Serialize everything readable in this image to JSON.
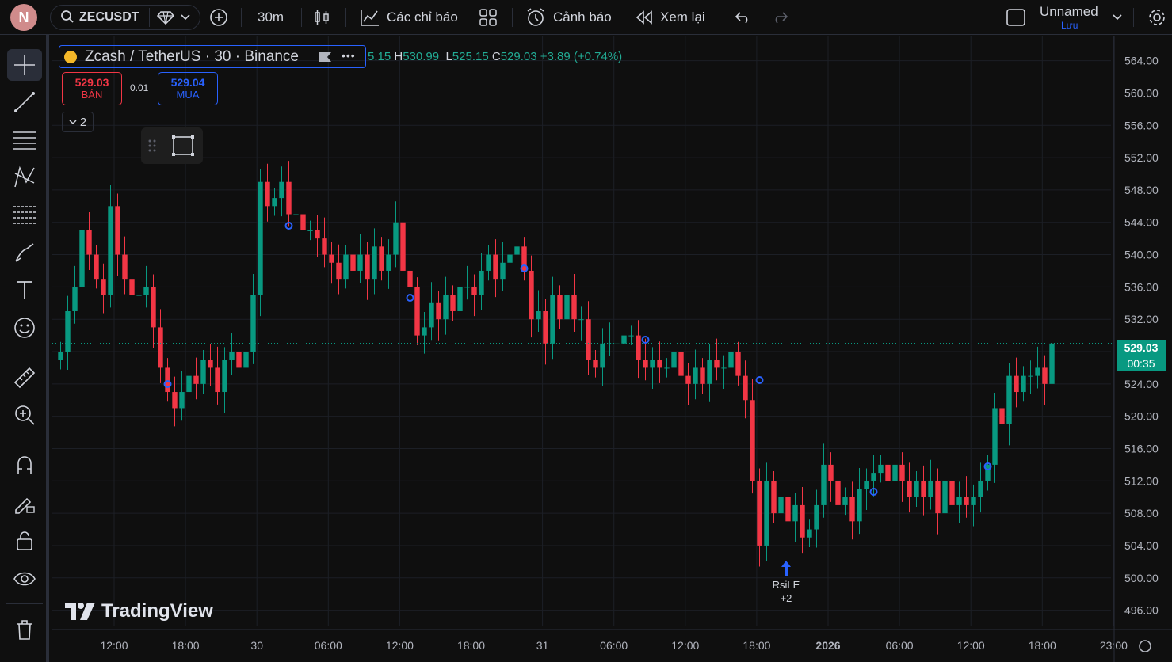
{
  "header": {
    "avatar_letter": "N",
    "symbol": "ZECUSDT",
    "interval": "30m",
    "indicators_label": "Các chỉ báo",
    "alerts_label": "Cảnh báo",
    "replay_label": "Xem lại",
    "layout_name": "Unnamed",
    "save_label": "Lưu"
  },
  "legend": {
    "title": "Zcash / TetherUS · 30 · Binance",
    "open_partial": "5.15",
    "high_key": "H",
    "high": "530.99",
    "low_key": "L",
    "low": "525.15",
    "close_key": "C",
    "close": "529.03",
    "change": "+3.89 (+0.74%)"
  },
  "trade": {
    "sell_price": "529.03",
    "sell_label": "BÁN",
    "spread": "0.01",
    "buy_price": "529.04",
    "buy_label": "MUA",
    "collapsed_count": "2"
  },
  "price_tag": {
    "price": "529.03",
    "countdown": "00:35"
  },
  "signal": {
    "label": "RsiLE",
    "extra": "+2"
  },
  "logo_text": "TradingView",
  "colors": {
    "up": "#089981",
    "down": "#f23645",
    "accent": "#2962ff",
    "background": "#0f0f0f"
  },
  "chart_data": {
    "type": "candlestick",
    "symbol": "ZECUSDT",
    "interval": "30m",
    "ylim": [
      494,
      567
    ],
    "y_ticks": [
      "564.00",
      "560.00",
      "556.00",
      "552.00",
      "548.00",
      "544.00",
      "540.00",
      "536.00",
      "532.00",
      "528.00",
      "524.00",
      "520.00",
      "516.00",
      "512.00",
      "508.00",
      "504.00",
      "500.00",
      "496.00"
    ],
    "x_ticks": [
      "12:00",
      "18:00",
      "30",
      "06:00",
      "12:00",
      "18:00",
      "31",
      "06:00",
      "12:00",
      "18:00",
      "2026",
      "06:00",
      "12:00",
      "18:00",
      "23:00"
    ],
    "last_price": 529.03,
    "closes": [
      528,
      533,
      536,
      543,
      540,
      537,
      535,
      546,
      540,
      537,
      535,
      535,
      536,
      531,
      526,
      523,
      521,
      523,
      525,
      524,
      527,
      526,
      523,
      527,
      528,
      526,
      528,
      535,
      549,
      546,
      547,
      549,
      545,
      545,
      543,
      543,
      542,
      540,
      539,
      537,
      540,
      538,
      540,
      537,
      541,
      538,
      540,
      544,
      538,
      536,
      530,
      531,
      534,
      532,
      535,
      533,
      536,
      536,
      535,
      538,
      540,
      537,
      539,
      540,
      541,
      538,
      532,
      533,
      529,
      535,
      532,
      535,
      532,
      532,
      527,
      526,
      529,
      529,
      529,
      530,
      530,
      527,
      526,
      527,
      526,
      526,
      528,
      525,
      524,
      526,
      524,
      527,
      526,
      526,
      528,
      525,
      522,
      512,
      504,
      512,
      508,
      510,
      507,
      509,
      505,
      506,
      509,
      514,
      512,
      509,
      510,
      507,
      511,
      512,
      513,
      514,
      512,
      514,
      512,
      510,
      512,
      510,
      512,
      508,
      512,
      509,
      510,
      509,
      510,
      512,
      514,
      521,
      519,
      525,
      523,
      525,
      525,
      526,
      524,
      529
    ]
  }
}
